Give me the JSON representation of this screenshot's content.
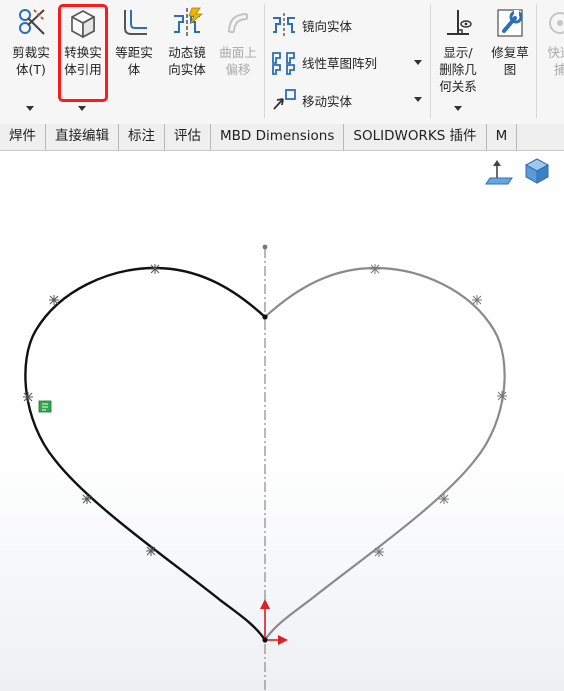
{
  "ribbon": {
    "tools": [
      {
        "id": "trim",
        "label": "剪裁实\n体(T)",
        "icon": "trim-entities-icon",
        "enabled": true,
        "has_dropdown": true
      },
      {
        "id": "convert",
        "label": "转换实\n体引用",
        "icon": "convert-entities-icon",
        "enabled": true,
        "has_dropdown": true,
        "highlighted": true
      },
      {
        "id": "offset",
        "label": "等距实\n体",
        "icon": "offset-entities-icon",
        "enabled": true
      },
      {
        "id": "dynamic-mirror",
        "label": "动态镜\n向实体",
        "icon": "dynamic-mirror-icon",
        "enabled": true
      },
      {
        "id": "surface-offset",
        "label": "曲面上\n偏移",
        "icon": "offset-on-surface-icon",
        "enabled": false
      }
    ],
    "row_tools": [
      {
        "id": "mirror",
        "label": "镜向实体",
        "icon": "mirror-entities-icon"
      },
      {
        "id": "linear-pattern",
        "label": "线性草图阵列",
        "icon": "linear-pattern-icon"
      },
      {
        "id": "move",
        "label": "移动实体",
        "icon": "move-entities-icon"
      }
    ],
    "right_tools": [
      {
        "id": "display-relations",
        "label": "显示/\n删除几\n何关系",
        "icon": "display-delete-relations-icon",
        "enabled": true
      },
      {
        "id": "repair",
        "label": "修复草\n图",
        "icon": "repair-sketch-icon",
        "enabled": true
      },
      {
        "id": "quick-snaps",
        "label": "快速\n捕",
        "icon": "quick-snaps-icon",
        "enabled": false
      }
    ]
  },
  "tabs": [
    "焊件",
    "直接编辑",
    "标注",
    "评估",
    "MBD Dimensions",
    "SOLIDWORKS 插件",
    "M"
  ],
  "view_icons": [
    "normal-to-icon",
    "view-cube-icon"
  ],
  "colors": {
    "highlight": "#ff1a1a",
    "sketch_selected": "#111111",
    "sketch_mirrored": "#8a8a8a",
    "x_axis": "#e02020",
    "y_axis": "#e02020",
    "relation_badge": "#2fa84f"
  }
}
